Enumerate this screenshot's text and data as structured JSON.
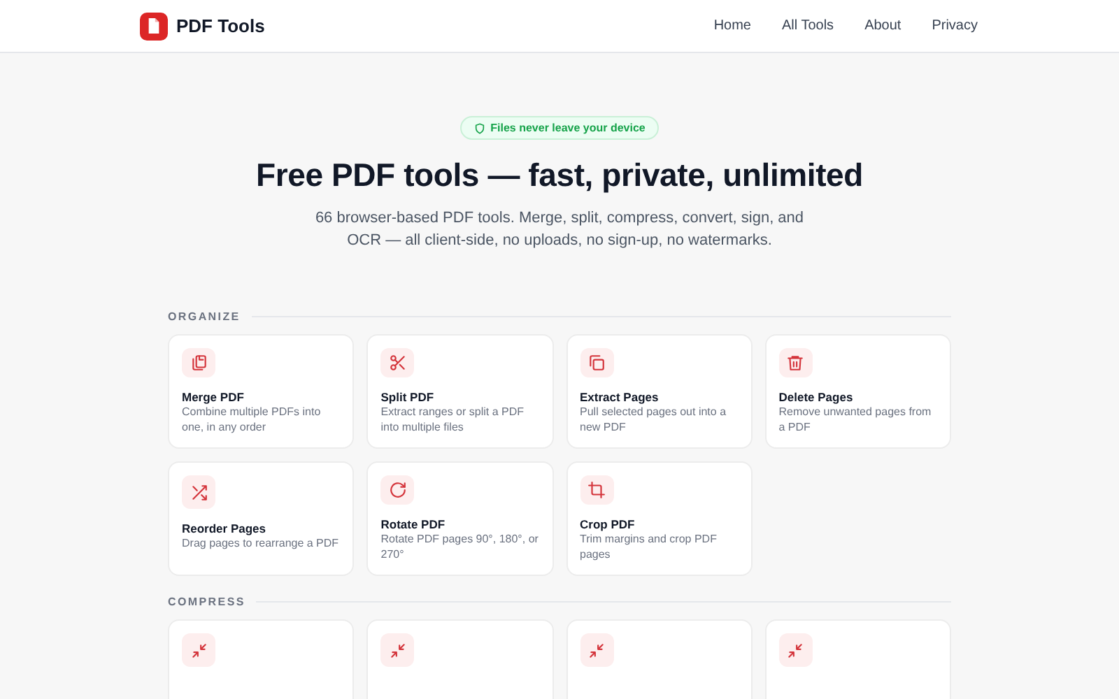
{
  "header": {
    "brand": "PDF Tools",
    "nav": [
      {
        "label": "Home"
      },
      {
        "label": "All Tools"
      },
      {
        "label": "About"
      },
      {
        "label": "Privacy"
      }
    ]
  },
  "hero": {
    "badge": "Files never leave your device",
    "title": "Free PDF tools — fast, private, unlimited",
    "subtitle": "66 browser-based PDF tools. Merge, split, compress, convert, sign, and OCR — all client-side, no uploads, no sign-up, no watermarks."
  },
  "sections": [
    {
      "heading": "ORGANIZE",
      "tools": [
        {
          "kind": "merge",
          "name": "Merge PDF",
          "description": "Combine multiple PDFs into one, in any order"
        },
        {
          "kind": "split",
          "name": "Split PDF",
          "description": "Extract ranges or split a PDF into multiple files"
        },
        {
          "kind": "extract",
          "name": "Extract Pages",
          "description": "Pull selected pages out into a new PDF"
        },
        {
          "kind": "delete",
          "name": "Delete Pages",
          "description": "Remove unwanted pages from a PDF"
        },
        {
          "kind": "reorder",
          "name": "Reorder Pages",
          "description": "Drag pages to rearrange a PDF"
        },
        {
          "kind": "rotate",
          "name": "Rotate PDF",
          "description": "Rotate PDF pages 90°, 180°, or 270°"
        },
        {
          "kind": "crop",
          "name": "Crop PDF",
          "description": "Trim margins and crop PDF pages"
        }
      ]
    },
    {
      "heading": "COMPRESS",
      "tools": [
        {
          "kind": "compress"
        },
        {
          "kind": "compress"
        },
        {
          "kind": "compress"
        },
        {
          "kind": "compress"
        }
      ]
    }
  ]
}
